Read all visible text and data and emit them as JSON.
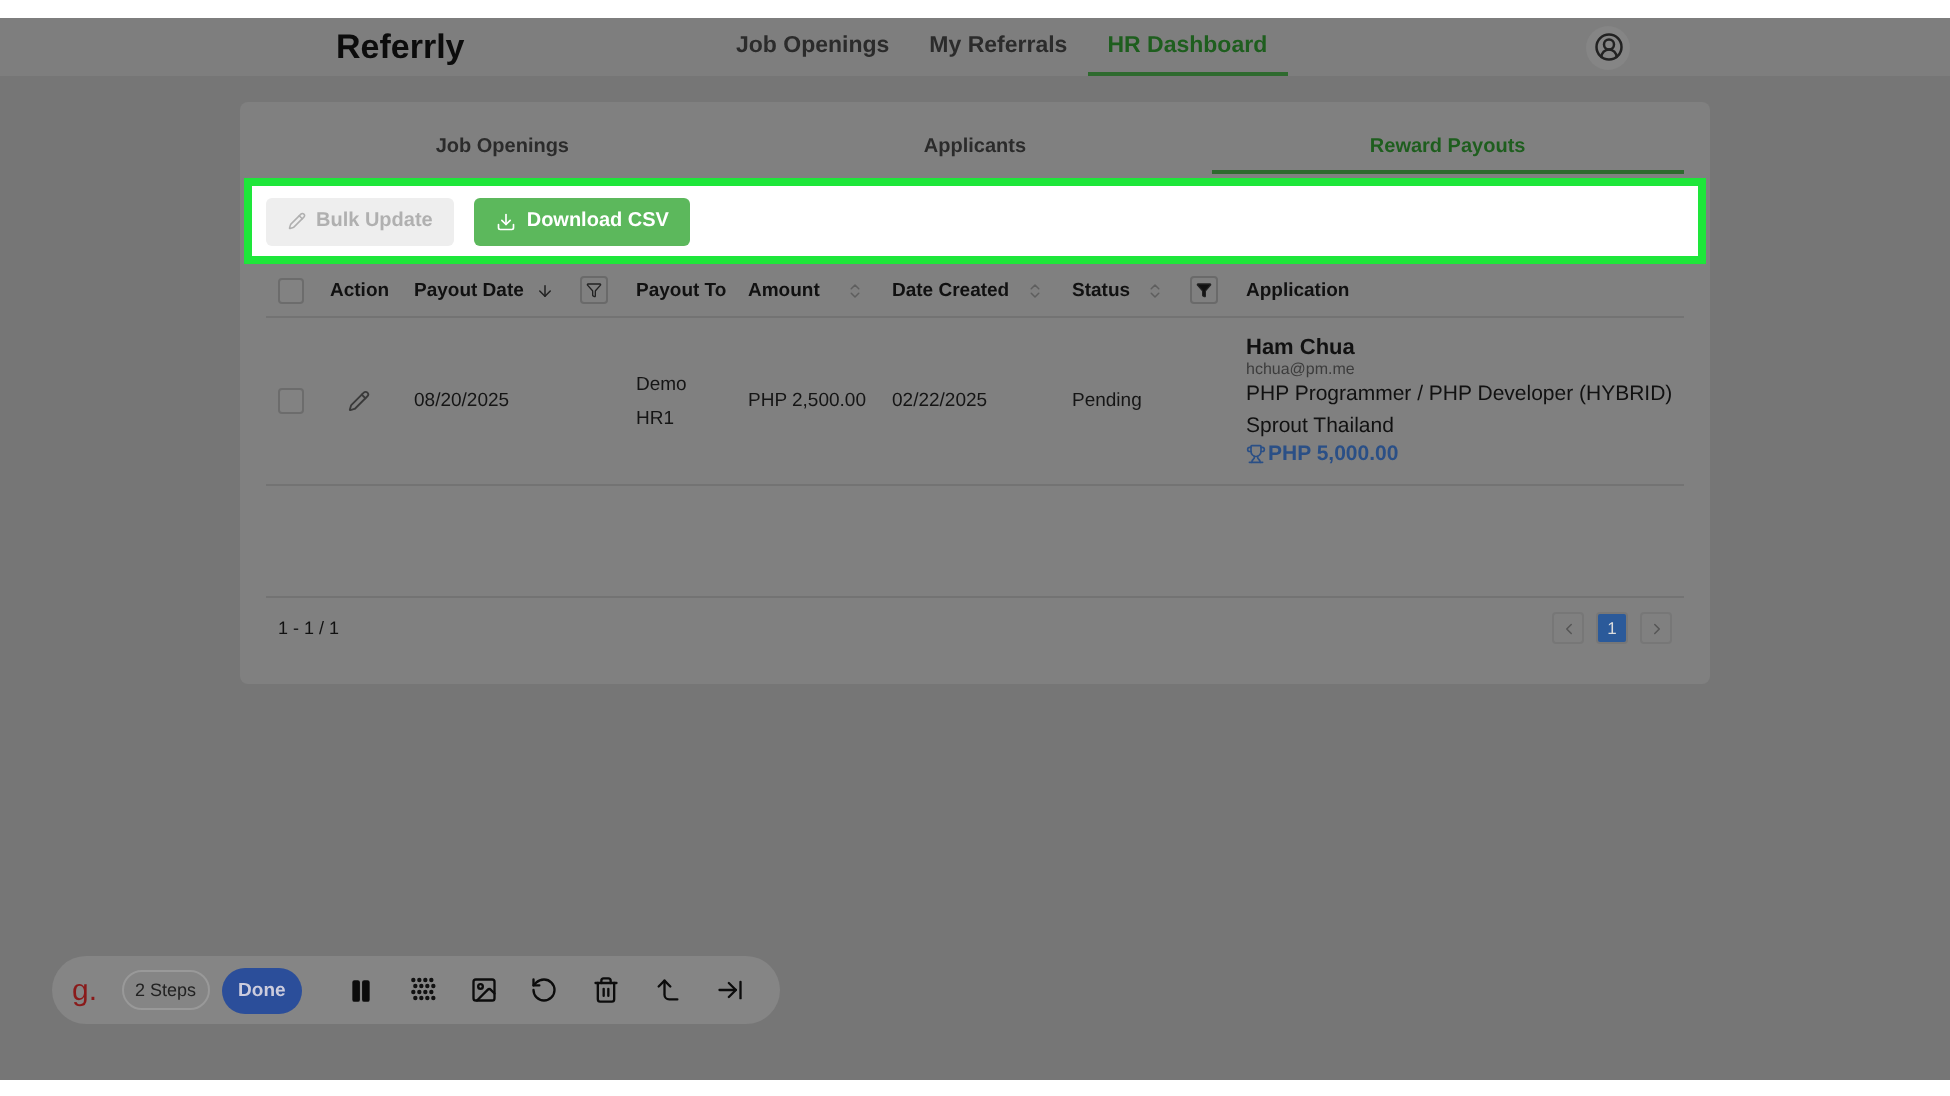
{
  "header": {
    "logo": "Referrly",
    "nav": [
      {
        "label": "Job Openings",
        "selected": false
      },
      {
        "label": "My Referrals",
        "selected": false
      },
      {
        "label": "HR Dashboard",
        "selected": true
      }
    ]
  },
  "tabs": [
    {
      "label": "Job Openings",
      "selected": false
    },
    {
      "label": "Applicants",
      "selected": false
    },
    {
      "label": "Reward Payouts",
      "selected": true
    }
  ],
  "actions": [
    {
      "kind": "edit",
      "label": "Bulk Update",
      "disabled": true
    },
    {
      "kind": "download",
      "label": "Download CSV",
      "disabled": false
    }
  ],
  "table": {
    "select_all": {
      "checked": false
    },
    "columns": [
      {
        "label": "Action",
        "sortable": false,
        "filterable": false
      },
      {
        "label": "Payout Date",
        "sortable": true,
        "sorted": true,
        "filterable": true,
        "filtered": false
      },
      {
        "label": "Payout To",
        "sortable": false,
        "filterable": false
      },
      {
        "label": "Amount",
        "sortable": true,
        "sorted": false,
        "filterable": false
      },
      {
        "label": "Date Created",
        "sortable": true,
        "sorted": false,
        "filterable": false
      },
      {
        "label": "Status",
        "sortable": true,
        "sorted": false,
        "filterable": true,
        "filtered": true
      },
      {
        "label": "Application",
        "sortable": false,
        "filterable": false
      }
    ],
    "rows": [
      {
        "checked": false,
        "payout_date": "08/20/2025",
        "payout_to": "Demo HR1",
        "amount": "PHP 2,500.00",
        "date_created": "02/22/2025",
        "status": "Pending",
        "application": {
          "name": "Ham Chua",
          "email": "hchua@pm.me",
          "position": "PHP Programmer / PHP Developer (HYBRID)",
          "company": "Sprout Thailand",
          "reward": "PHP 5,000.00"
        }
      }
    ]
  },
  "pagination": {
    "range": "1 - 1 / 1",
    "pages": [
      {
        "label": "1",
        "selected": true
      }
    ]
  },
  "recorder": {
    "logo": "g.",
    "steps": "2 Steps",
    "done": "Done"
  }
}
